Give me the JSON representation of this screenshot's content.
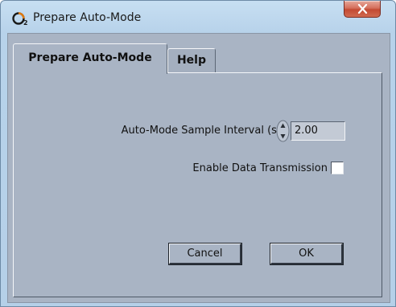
{
  "window": {
    "title": "Prepare Auto-Mode",
    "icon": "o2-app-icon",
    "close_icon": "close-icon"
  },
  "tabs": [
    {
      "label": "Prepare Auto-Mode",
      "selected": true
    },
    {
      "label": "Help",
      "selected": false
    }
  ],
  "form": {
    "interval_label": "Auto-Mode Sample Interval (s)",
    "interval_value": "2.00",
    "transmission_label": "Enable Data Transmission",
    "transmission_checked": false
  },
  "buttons": {
    "cancel_label": "Cancel",
    "ok_label": "OK"
  }
}
